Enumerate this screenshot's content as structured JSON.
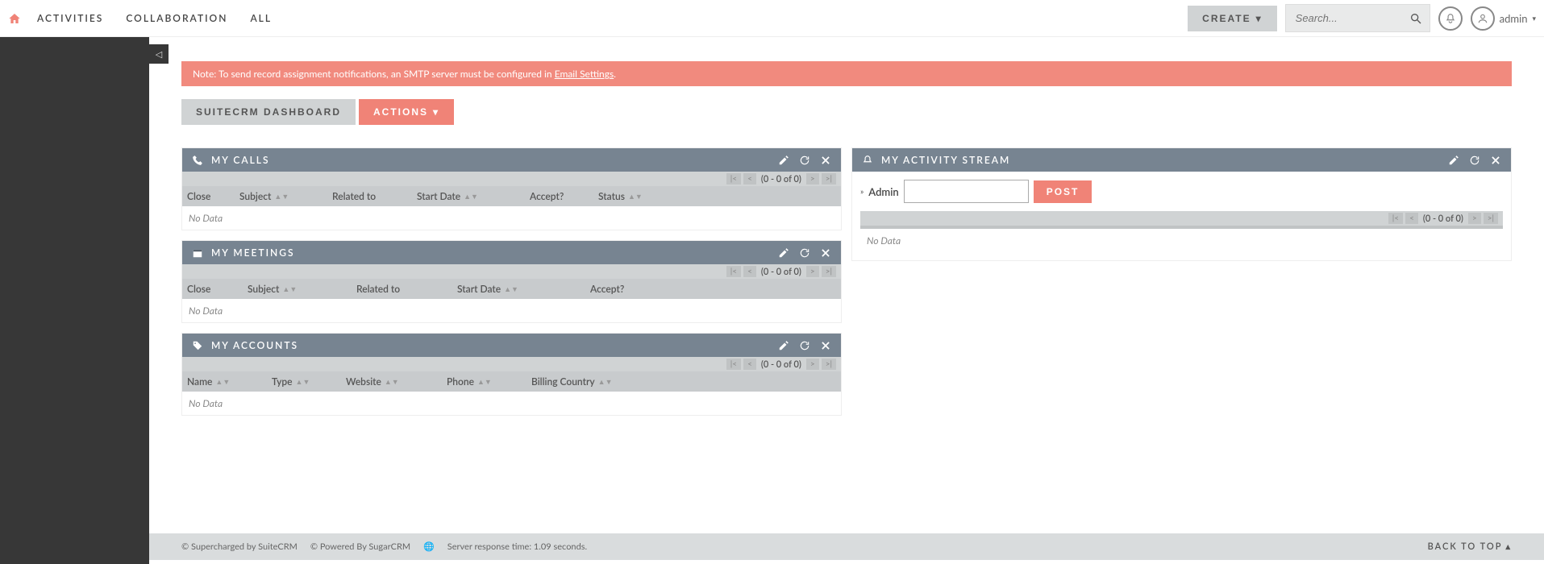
{
  "nav": {
    "activities": "Activities",
    "collaboration": "Collaboration",
    "all": "All"
  },
  "topbar": {
    "create": "Create",
    "search_placeholder": "Search...",
    "username": "admin"
  },
  "alert": {
    "prefix": "Note: To send record assignment notifications, an SMTP server must be configured in ",
    "link": "Email Settings",
    "suffix": "."
  },
  "tabs": {
    "dashboard": "SuiteCRM Dashboard",
    "actions": "Actions"
  },
  "pager": {
    "text": "(0 - 0 of 0)"
  },
  "nodata": "No Data",
  "calls": {
    "title": "My Calls",
    "cols": {
      "close": "Close",
      "subject": "Subject",
      "related": "Related to",
      "start": "Start Date",
      "accept": "Accept?",
      "status": "Status"
    }
  },
  "meetings": {
    "title": "My Meetings",
    "cols": {
      "close": "Close",
      "subject": "Subject",
      "related": "Related to",
      "start": "Start Date",
      "accept": "Accept?"
    }
  },
  "accounts": {
    "title": "My Accounts",
    "cols": {
      "name": "Name",
      "type": "Type",
      "website": "Website",
      "phone": "Phone",
      "country": "Billing Country"
    }
  },
  "activity": {
    "title": "My Activity Stream",
    "label": "Admin",
    "post": "Post"
  },
  "footer": {
    "supercharged": "© Supercharged by SuiteCRM",
    "powered": "© Powered By SugarCRM",
    "server": "Server response time: 1.09 seconds.",
    "back": "Back to top"
  }
}
